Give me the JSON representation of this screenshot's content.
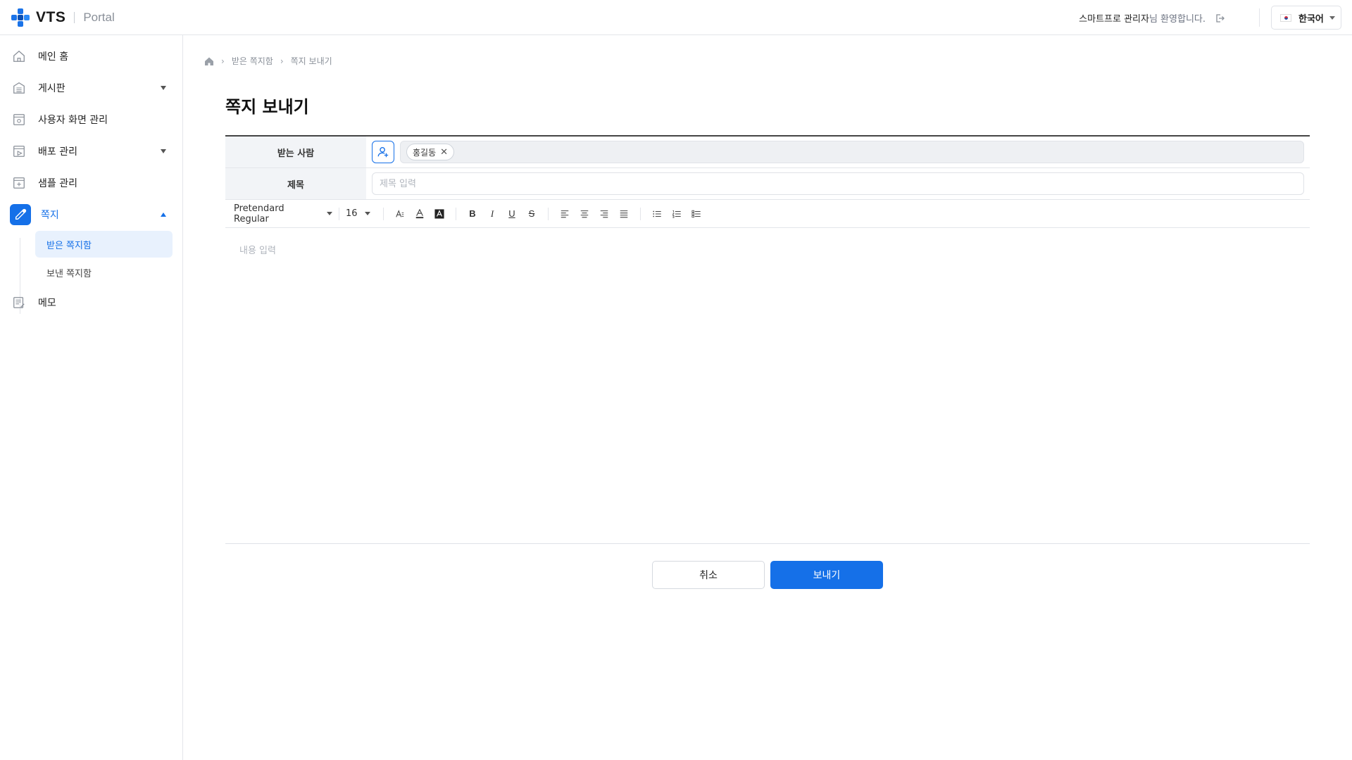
{
  "header": {
    "logo_text": "VTS",
    "logo_sub": "Portal",
    "user_name": "스마트프로 관리자",
    "welcome_suffix": "님 환영합니다.",
    "language": "한국어"
  },
  "sidebar": {
    "items": [
      {
        "label": "메인 홈",
        "icon": "home-icon"
      },
      {
        "label": "게시판",
        "icon": "board-icon"
      },
      {
        "label": "사용자 화면 관리",
        "icon": "user-screen-icon"
      },
      {
        "label": "배포 관리",
        "icon": "deploy-icon"
      },
      {
        "label": "샘플 관리",
        "icon": "sample-icon"
      },
      {
        "label": "쪽지",
        "icon": "message-icon"
      },
      {
        "label": "메모",
        "icon": "memo-icon"
      }
    ],
    "sub_items": [
      {
        "label": "받은 쪽지함"
      },
      {
        "label": "보낸 쪽지함"
      }
    ]
  },
  "breadcrumb": [
    "받은 쪽지함",
    "쪽지 보내기"
  ],
  "page_title": "쪽지 보내기",
  "form": {
    "recipient_label": "받는 사람",
    "recipients": [
      "홍길동"
    ],
    "subject_label": "제목",
    "subject_placeholder": "제목 입력",
    "subject_value": "",
    "content_placeholder": "내용 입력"
  },
  "toolbar": {
    "font_family": "Pretendard Regular",
    "font_size": "16"
  },
  "actions": {
    "cancel": "취소",
    "send": "보내기"
  },
  "colors": {
    "accent": "#1570e8",
    "label_bg": "#f2f4f7"
  }
}
